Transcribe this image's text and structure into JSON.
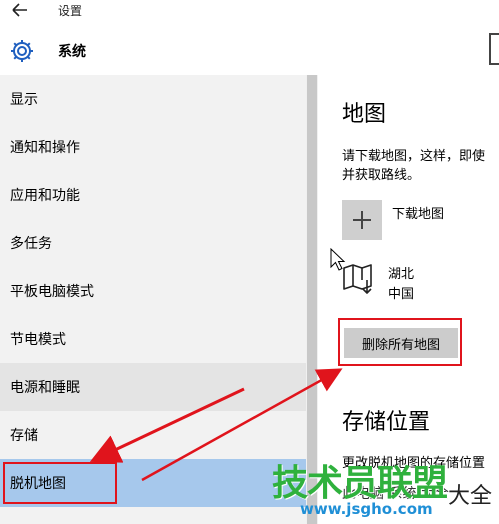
{
  "window": {
    "title": "设置",
    "back_icon": "arrow-left-icon"
  },
  "header": {
    "section": "系统",
    "icon": "gear-icon"
  },
  "sidebar": {
    "items": [
      {
        "label": "显示"
      },
      {
        "label": "通知和操作"
      },
      {
        "label": "应用和功能"
      },
      {
        "label": "多任务"
      },
      {
        "label": "平板电脑模式"
      },
      {
        "label": "节电模式"
      },
      {
        "label": "电源和睡眠"
      },
      {
        "label": "存储"
      },
      {
        "label": "脱机地图"
      }
    ],
    "selected_index": 8
  },
  "main": {
    "heading": "地图",
    "description_line1": "请下载地图，这样，即使",
    "description_line2": "并获取路线。",
    "download_label": "下载地图",
    "download_icon": "plus-icon",
    "map_entry": {
      "name": "湖北",
      "country": "中国",
      "icon": "map-download-icon"
    },
    "delete_all_label": "删除所有地图",
    "storage_heading": "存储位置",
    "storage_desc": "更改脱机地图的存储位置",
    "storage_cut": "此电脑 系统 大全"
  },
  "watermark": {
    "text": "技术员联盟",
    "url": "www.jsgho.com",
    "side": "大全"
  },
  "colors": {
    "sidebar_bg": "#f2f2f2",
    "selected_bg": "#a6c8ec",
    "annotation_red": "#e0141c",
    "button_bg": "#cccccc"
  }
}
